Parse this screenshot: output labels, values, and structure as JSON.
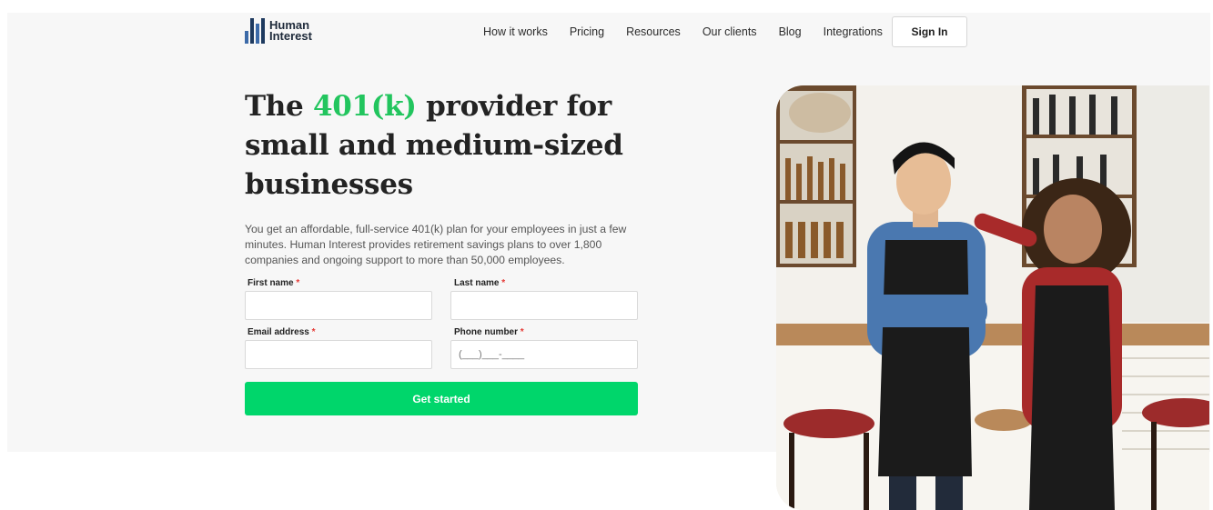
{
  "brand": {
    "line1": "Human",
    "line2": "Interest"
  },
  "nav": {
    "items": [
      "How it works",
      "Pricing",
      "Resources",
      "Our clients",
      "Blog",
      "Integrations"
    ],
    "signin_label": "Sign In"
  },
  "hero": {
    "title_part1": "The ",
    "title_accent": "401(k)",
    "title_part2": " provider for small and medium-sized businesses",
    "subtitle": "You get an affordable, full-service 401(k) plan for your employees in just a few minutes. Human Interest provides retirement savings plans to over 1,800 companies and ongoing support to more than 50,000 employees.",
    "accent_color": "#22c55e"
  },
  "form": {
    "first_name_label": "First name",
    "last_name_label": "Last name",
    "email_label": "Email address",
    "phone_label": "Phone number",
    "required_mark": "*",
    "first_name_value": "",
    "last_name_value": "",
    "email_value": "",
    "phone_placeholder": "(___)___-____",
    "submit_label": "Get started",
    "submit_color": "#00d66b"
  },
  "image": {
    "icon": "photo-two-baristas"
  }
}
